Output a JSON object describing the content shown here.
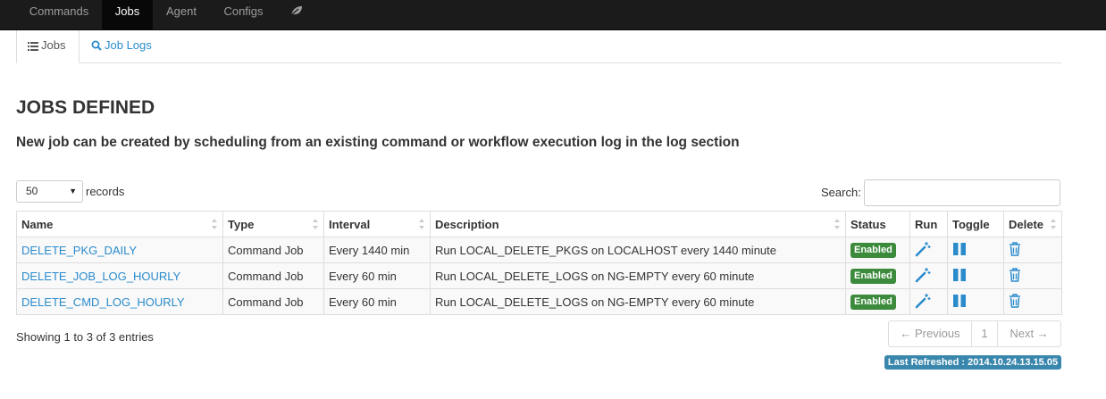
{
  "navbar": {
    "items": [
      {
        "label": "Commands",
        "active": false
      },
      {
        "label": "Jobs",
        "active": true
      },
      {
        "label": "Agent",
        "active": false
      },
      {
        "label": "Configs",
        "active": false
      }
    ],
    "extra_icon": "leaf-icon"
  },
  "tabs": [
    {
      "label": "Jobs",
      "icon": "list-icon",
      "active": true
    },
    {
      "label": "Job Logs",
      "icon": "search-icon",
      "active": false
    }
  ],
  "page": {
    "title": "JOBS DEFINED",
    "subtitle": "New job can be created by scheduling from an existing command or workflow execution log in the log section"
  },
  "controls": {
    "length_value": "50",
    "length_label": "records",
    "search_label": "Search:",
    "search_value": ""
  },
  "table": {
    "columns": [
      "Name",
      "Type",
      "Interval",
      "Description",
      "Status",
      "Run",
      "Toggle",
      "Delete"
    ],
    "rows": [
      {
        "name": "DELETE_PKG_DAILY",
        "type": "Command Job",
        "interval": "Every 1440 min",
        "description": "Run LOCAL_DELETE_PKGS on LOCALHOST every 1440 minute",
        "status": "Enabled"
      },
      {
        "name": "DELETE_JOB_LOG_HOURLY",
        "type": "Command Job",
        "interval": "Every 60 min",
        "description": "Run LOCAL_DELETE_LOGS on NG-EMPTY every 60 minute",
        "status": "Enabled"
      },
      {
        "name": "DELETE_CMD_LOG_HOURLY",
        "type": "Command Job",
        "interval": "Every 60 min",
        "description": "Run LOCAL_DELETE_LOGS on NG-EMPTY every 60 minute",
        "status": "Enabled"
      }
    ]
  },
  "footer": {
    "info": "Showing 1 to 3 of 3 entries",
    "pagination": {
      "previous": "← Previous",
      "page": "1",
      "next": "Next →"
    },
    "last_refreshed": "Last Refreshed : 2014.10.24.13.15.05"
  },
  "colors": {
    "navbar_bg": "#1b1b1b",
    "link": "#2a8bcc",
    "enabled_badge": "#3c8b3c",
    "refreshed_badge": "#3a87ad"
  }
}
